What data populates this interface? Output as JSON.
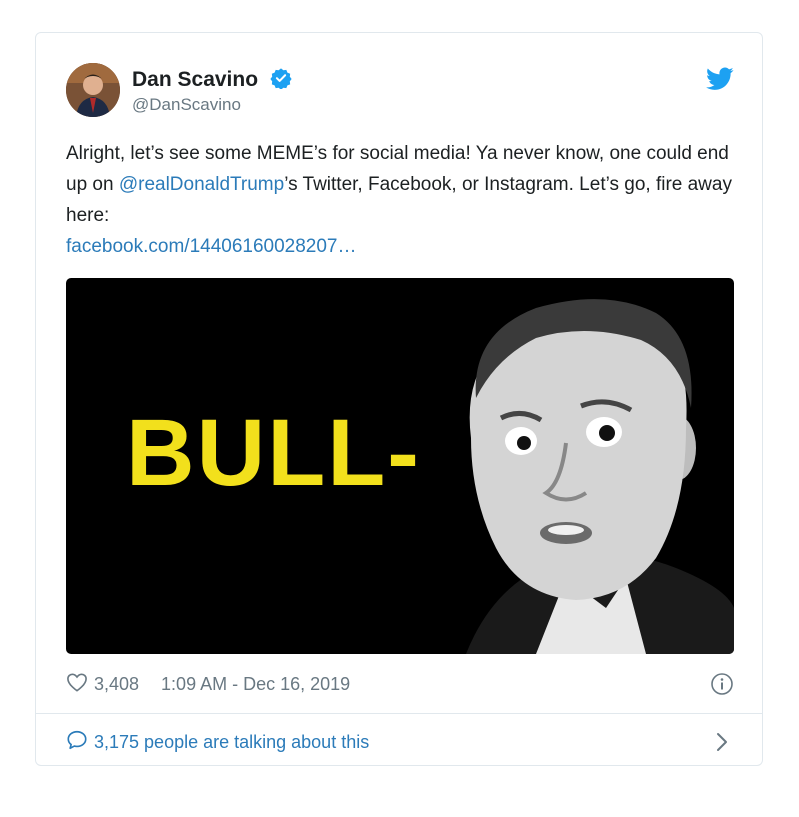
{
  "tweet": {
    "author_name": "Dan Scavino",
    "author_handle": "@DanScavino",
    "text_part1": "Alright, let’s see some MEME’s for social media! Ya never know, one could end up on ",
    "mention": "@realDonaldTrump",
    "text_part2": "’s Twitter, Facebook, or Instagram. Let’s go, fire away here:",
    "link": "facebook.com/14406160028207…",
    "media_caption": "BULL-",
    "likes": "3,408",
    "timestamp": "1:09 AM - Dec 16, 2019",
    "talking": "3,175 people are talking about this"
  },
  "icons": {
    "verified": "verified-badge-icon",
    "bird": "twitter-bird-icon",
    "heart": "heart-icon",
    "info": "info-icon",
    "comment": "comment-bubble-icon",
    "chevron": "chevron-right-icon"
  },
  "colors": {
    "link": "#2b7bb9",
    "bird": "#1da1f2",
    "secondary_text": "#697882",
    "meme_text": "#f2e01c"
  }
}
